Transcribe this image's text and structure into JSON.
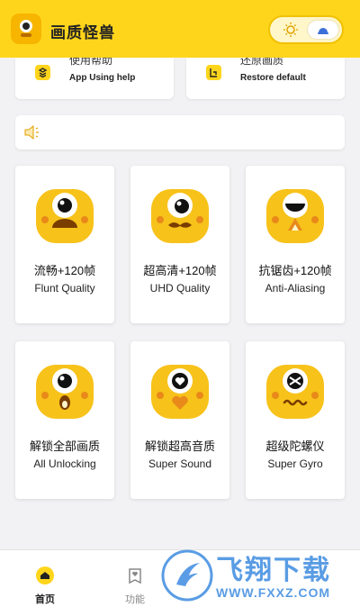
{
  "header": {
    "title": "画质怪兽",
    "logo_icon": "monster-logo-icon",
    "toggle": {
      "left_icon": "sun-icon",
      "right_icon": "moon-icon"
    }
  },
  "quick_actions": [
    {
      "title": "使用帮助",
      "subtitle": "App Using help",
      "icon": "help-icon"
    },
    {
      "title": "还原画质",
      "subtitle": "Restore default",
      "icon": "restore-icon"
    }
  ],
  "notice": {
    "icon": "speaker-icon",
    "text": ""
  },
  "cards": [
    {
      "title": "流畅+120帧",
      "subtitle": "Flunt Quality",
      "icon": "mascot-smile-icon"
    },
    {
      "title": "超高清+120帧",
      "subtitle": "UHD Quality",
      "icon": "mascot-mustache-icon"
    },
    {
      "title": "抗锯齿+120帧",
      "subtitle": "Anti-Aliasing",
      "icon": "mascot-fang-icon"
    },
    {
      "title": "解锁全部画质",
      "subtitle": "All Unlocking",
      "icon": "mascot-surprised-icon"
    },
    {
      "title": "解锁超高音质",
      "subtitle": "Super Sound",
      "icon": "mascot-heart-icon"
    },
    {
      "title": "超级陀螺仪",
      "subtitle": "Super Gyro",
      "icon": "mascot-dizzy-icon"
    }
  ],
  "tabs": [
    {
      "label": "首页",
      "icon": "home-icon",
      "active": true
    },
    {
      "label": "功能",
      "icon": "function-icon",
      "active": false
    }
  ],
  "watermark": {
    "text": "飞翔下载",
    "url": "WWW.FXXZ.COM"
  },
  "colors": {
    "accent": "#ffd51c",
    "mascot": "#f7c21a",
    "cheek": "#e8891a"
  }
}
